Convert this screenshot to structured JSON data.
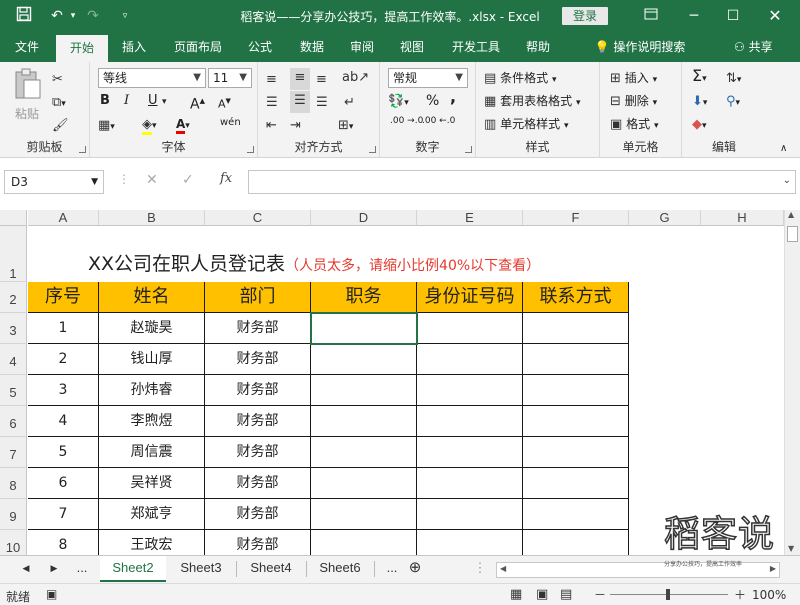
{
  "titlebar": {
    "title": "稻客说——分享办公技巧，提高工作效率。.xlsx  -  Excel",
    "login": "登录"
  },
  "tabs": [
    "文件",
    "开始",
    "插入",
    "页面布局",
    "公式",
    "数据",
    "审阅",
    "视图",
    "开发工具",
    "帮助"
  ],
  "tell_me": "操作说明搜索",
  "share": "共享",
  "ribbon": {
    "clipboard": {
      "label": "剪贴板",
      "paste": "粘贴"
    },
    "font": {
      "label": "字体",
      "name": "等线",
      "size": "11",
      "bold": "B",
      "italic": "I",
      "underline": "U",
      "grow": "A",
      "shrink": "A",
      "phonetic": "wén"
    },
    "alignment": {
      "label": "对齐方式"
    },
    "number": {
      "label": "数字",
      "format": "常规",
      "percent": "%",
      "comma": ",",
      "inc_dec": ".00 →.0",
      "dec_dec": ".00 ←.0"
    },
    "styles": {
      "label": "样式",
      "conditional": "条件格式",
      "table": "套用表格格式",
      "cell": "单元格样式"
    },
    "cells": {
      "label": "单元格",
      "insert": "插入",
      "delete": "删除",
      "format": "格式"
    },
    "editing": {
      "label": "编辑"
    }
  },
  "namebox": "D3",
  "columns": [
    "A",
    "B",
    "C",
    "D",
    "E",
    "F",
    "G",
    "H"
  ],
  "rows": [
    "1",
    "2",
    "3",
    "4",
    "5",
    "6",
    "7",
    "8",
    "9",
    "10"
  ],
  "sheet": {
    "title": "XX公司在职人员登记表",
    "note": "（人员太多，请缩小比例40%以下查看）",
    "headers": [
      "序号",
      "姓名",
      "部门",
      "职务",
      "身份证号码",
      "联系方式"
    ],
    "records": [
      [
        "1",
        "赵璇昊",
        "财务部"
      ],
      [
        "2",
        "钱山厚",
        "财务部"
      ],
      [
        "3",
        "孙炜睿",
        "财务部"
      ],
      [
        "4",
        "李煦煜",
        "财务部"
      ],
      [
        "5",
        "周信震",
        "财务部"
      ],
      [
        "6",
        "吴祥贤",
        "财务部"
      ],
      [
        "7",
        "郑斌亨",
        "财务部"
      ],
      [
        "8",
        "王政宏",
        "财务部"
      ]
    ]
  },
  "sheet_tabs": [
    "Sheet2",
    "Sheet3",
    "Sheet4",
    "Sheet6"
  ],
  "ellipsis": "...",
  "status": {
    "ready": "就绪",
    "zoom": "100%"
  },
  "watermark": {
    "logo": "稻客说",
    "tagline": "分享办公技巧，提高工作效率"
  },
  "colors": {
    "accent": "#217346",
    "header_fill": "#ffc000",
    "note": "#e53a2f"
  }
}
